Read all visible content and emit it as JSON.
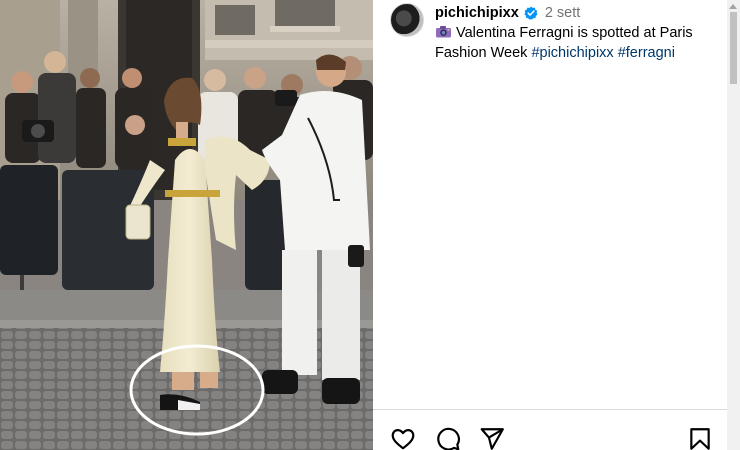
{
  "post": {
    "username": "pichichipixx",
    "time_ago": "2 sett",
    "caption": {
      "emoji_icon": "camera-icon",
      "text": "Valentina Ferragni is spotted at Paris Fashion Week",
      "hashtags": [
        "#pichichipixx",
        "#ferragni"
      ]
    }
  },
  "actions": {
    "icons": [
      "heart-icon",
      "comment-icon",
      "share-icon",
      "bookmark-icon"
    ]
  },
  "colors": {
    "hashtag": "#00376b",
    "verified": "#0095f6",
    "time": "#737373"
  }
}
